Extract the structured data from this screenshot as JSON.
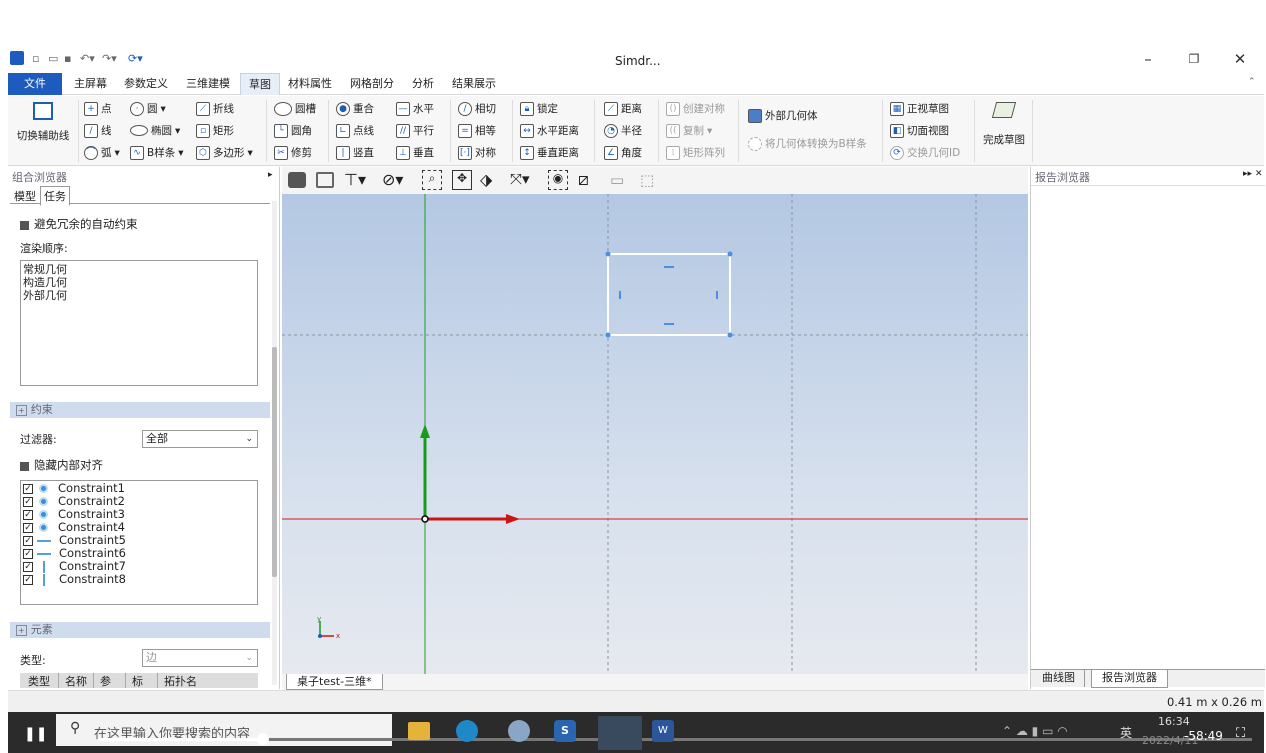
{
  "window": {
    "title": "Simdr..."
  },
  "menu": [
    "文件",
    "主屏幕",
    "参数定义",
    "三维建模",
    "草图",
    "材料属性",
    "网格剖分",
    "分析",
    "结果展示"
  ],
  "ribbon": {
    "toggle_aux": "切换辅助线",
    "point": "点",
    "line": "线",
    "arc": "弧",
    "circle": "圆",
    "ellipse": "椭圆",
    "bspline": "B样条",
    "polyline": "折线",
    "rect": "矩形",
    "polygon": "多边形",
    "slot": "圆槽",
    "fillet": "圆角",
    "trim": "修剪",
    "coincident": "重合",
    "point_on": "点线",
    "vertical": "竖直",
    "horizontal": "水平",
    "parallel": "平行",
    "perpendicular": "垂直",
    "tangent": "相切",
    "equal": "相等",
    "symmetric": "对称",
    "lock": "锁定",
    "h_distance": "水平距离",
    "v_distance": "垂直距离",
    "distance": "距离",
    "radius": "半径",
    "angle": "角度",
    "create_sym": "创建对称",
    "copy": "复制",
    "rect_array": "矩形阵列",
    "external": "外部几何体",
    "convert_bspline": "将几何体转换为B样条",
    "view_sketch": "正视草图",
    "section_view": "切面视图",
    "swap_id": "交换几何ID",
    "finish": "完成草图"
  },
  "left": {
    "title": "组合浏览器",
    "tabs": [
      "模型",
      "任务"
    ],
    "avoid_auto": "避免冗余的自动约束",
    "render_order_label": "渲染顺序:",
    "render_order": [
      "常规几何",
      "构造几何",
      "外部几何"
    ],
    "constraints_header": "约束",
    "filter_label": "过滤器:",
    "filter_value": "全部",
    "hide_internal": "隐藏内部对齐",
    "constraints": [
      "Constraint1",
      "Constraint2",
      "Constraint3",
      "Constraint4",
      "Constraint5",
      "Constraint6",
      "Constraint7",
      "Constraint8"
    ],
    "elements_header": "元素",
    "type_label": "类型:",
    "type_value": "边",
    "columns": [
      "类型",
      "名称",
      "参考",
      "标注",
      "拓扑名"
    ]
  },
  "canvas": {
    "tab": "桌子test-三维*"
  },
  "right": {
    "title": "报告浏览器",
    "tabs": [
      "曲线图",
      "报告浏览器"
    ]
  },
  "status": {
    "size": "0.41 m x 0.26 m"
  },
  "taskbar": {
    "search": "在这里输入你要搜索的内容",
    "time": "16:34",
    "date": "2022/4/11",
    "remaining": "-58:49",
    "lang": "英"
  }
}
